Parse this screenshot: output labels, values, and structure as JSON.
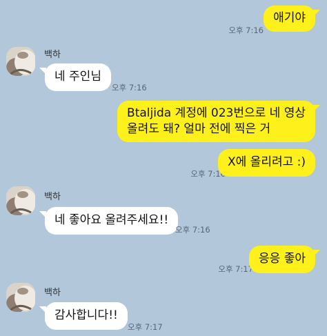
{
  "contact": {
    "name": "백하"
  },
  "messages": [
    {
      "text": "애기야",
      "time": "오후 7:16"
    },
    {
      "text": "네 주인님",
      "time": "오후 7:16"
    },
    {
      "line1": "Btaljida 계정에 023번으로 네 영상",
      "line2": "올려도 돼? 얼마 전에 찍은 거"
    },
    {
      "text": "X에 올리려고 :)",
      "time": "오후 7:16"
    },
    {
      "text": "네 좋아요 올려주세요!!",
      "time": "오후 7:16"
    },
    {
      "text": "응응 좋아",
      "time": "오후 7:17"
    },
    {
      "text": "감사합니다!!",
      "time": "오후 7:17"
    }
  ],
  "colors": {
    "background": "#b2c7da",
    "my_bubble": "#fef01b",
    "their_bubble": "#ffffff"
  }
}
